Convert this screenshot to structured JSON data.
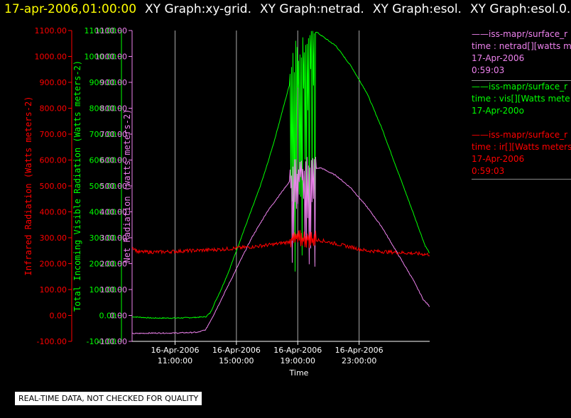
{
  "header": {
    "timestamp": "17-apr-2006,01:00:00",
    "titles": [
      "XY Graph:xy-grid.",
      "XY Graph:netrad.",
      "XY Graph:esol.",
      "XY Graph:esol.0."
    ]
  },
  "legend": [
    {
      "line1": "——iss-mapr/surface_r",
      "line2": "time : netrad[][watts me",
      "line3": "17-Apr-2006",
      "line4": "0:59:03",
      "color": "#ee82ee"
    },
    {
      "line1": "——iss-mapr/surface_r",
      "line2": "time : vis[][Watts mete",
      "line3": "17-Apr-200o",
      "line4": "",
      "color": "#00ff00"
    },
    {
      "line1": "——iss-mapr/surface_r",
      "line2": "time : ir[][Watts meters",
      "line3": "17-Apr-2006",
      "line4": "0:59:03",
      "color": "#ff0000"
    }
  ],
  "quality_note": "REAL-TIME DATA, NOT CHECKED FOR QUALITY",
  "chart_data": {
    "type": "line",
    "xlabel": "Time",
    "x_range_hours": [
      8.2,
      27.6
    ],
    "x_ticks": [
      {
        "hour": 11,
        "line1": "16-Apr-2006",
        "line2": "11:00:00"
      },
      {
        "hour": 15,
        "line1": "16-Apr-2006",
        "line2": "15:00:00"
      },
      {
        "hour": 19,
        "line1": "16-Apr-2006",
        "line2": "19:00:00"
      },
      {
        "hour": 23,
        "line1": "16-Apr-2006",
        "line2": "23:00:00"
      }
    ],
    "y_range": [
      -100,
      1100
    ],
    "y_ticks": [
      "1100.00",
      "1000.00",
      "900.00",
      "800.00",
      "700.00",
      "600.00",
      "500.00",
      "400.00",
      "300.00",
      "200.00",
      "100.00",
      "0.00",
      "-100.00"
    ],
    "axes": [
      {
        "label": "Infrared Radiation (Watts meters-2)",
        "color": "#ff0000"
      },
      {
        "label": "Total Incoming Visible Radiation (Watts meters-2)",
        "color": "#00ff00"
      },
      {
        "label": "Net Radiation (watts meters-2)",
        "color": "#ee82ee"
      }
    ],
    "grid": "vertical",
    "series": [
      {
        "color": "#00ff00",
        "points": [
          [
            8.2,
            -5
          ],
          [
            9.5,
            -10
          ],
          [
            11.0,
            -10
          ],
          [
            12.2,
            -8
          ],
          [
            13.0,
            -5
          ],
          [
            13.3,
            10
          ],
          [
            13.6,
            50
          ],
          [
            14.0,
            100
          ],
          [
            14.5,
            170
          ],
          [
            15.0,
            250
          ],
          [
            15.5,
            330
          ],
          [
            16.0,
            410
          ],
          [
            16.5,
            490
          ],
          [
            17.0,
            580
          ],
          [
            17.5,
            680
          ],
          [
            18.0,
            790
          ],
          [
            18.5,
            900
          ],
          [
            19.3,
            1000
          ],
          [
            20.2,
            1095
          ],
          [
            21.5,
            1040
          ],
          [
            22.5,
            960
          ],
          [
            23.5,
            860
          ],
          [
            24.5,
            720
          ],
          [
            25.5,
            560
          ],
          [
            26.5,
            400
          ],
          [
            27.3,
            270
          ],
          [
            27.6,
            240
          ]
        ],
        "noise_from": 18.5,
        "noise_to": 20.2,
        "noise_min": 120,
        "noise_max": 1100
      },
      {
        "color": "#ee82ee",
        "points": [
          [
            8.2,
            -70
          ],
          [
            9.5,
            -68
          ],
          [
            11.0,
            -68
          ],
          [
            12.5,
            -65
          ],
          [
            13.0,
            -55
          ],
          [
            13.5,
            0
          ],
          [
            14.0,
            60
          ],
          [
            14.5,
            120
          ],
          [
            15.0,
            180
          ],
          [
            15.5,
            240
          ],
          [
            16.0,
            300
          ],
          [
            16.5,
            350
          ],
          [
            17.0,
            400
          ],
          [
            17.5,
            440
          ],
          [
            18.0,
            480
          ],
          [
            18.5,
            520
          ],
          [
            19.5,
            560
          ],
          [
            20.5,
            570
          ],
          [
            21.5,
            540
          ],
          [
            22.5,
            490
          ],
          [
            23.5,
            420
          ],
          [
            24.5,
            340
          ],
          [
            25.5,
            240
          ],
          [
            26.5,
            140
          ],
          [
            27.2,
            60
          ],
          [
            27.6,
            35
          ]
        ],
        "noise_from": 18.5,
        "noise_to": 20.2,
        "noise_min": 130,
        "noise_max": 620
      },
      {
        "color": "#ff0000",
        "points": [
          [
            8.2,
            265
          ],
          [
            8.6,
            245
          ],
          [
            10.0,
            245
          ],
          [
            12.0,
            250
          ],
          [
            14.0,
            255
          ],
          [
            16.0,
            265
          ],
          [
            17.5,
            275
          ],
          [
            18.5,
            285
          ],
          [
            19.0,
            300
          ],
          [
            19.5,
            295
          ],
          [
            20.5,
            290
          ],
          [
            22.0,
            270
          ],
          [
            23.5,
            250
          ],
          [
            25.0,
            245
          ],
          [
            26.5,
            240
          ],
          [
            27.6,
            235
          ]
        ],
        "noise_from": 18.5,
        "noise_to": 20.2,
        "noise_min": 260,
        "noise_max": 330
      }
    ]
  }
}
